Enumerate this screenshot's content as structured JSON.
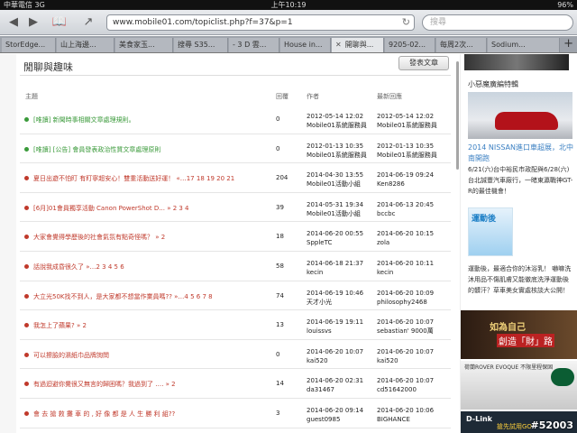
{
  "status": {
    "carrier": "中華電信 3G",
    "time": "上午10:19",
    "battery": "96%"
  },
  "browser": {
    "back": "◀",
    "forward": "▶",
    "bookmarks": "📖",
    "share": "↗",
    "url": "www.mobile01.com/topiclist.php?f=37&p=1",
    "search_placeholder": "搜尋",
    "tabs": [
      "StorEdge...",
      "山上海邊...",
      "美食家玉...",
      "搜尋 S35...",
      "- 3 D 雲...",
      "House in...",
      "開聊與...",
      "9205-02...",
      "每周2次...",
      "Sodium..."
    ],
    "new_tab": "+"
  },
  "forum": {
    "section_title": "閒聊與趣味",
    "post_button": "發表文章",
    "headers": {
      "topic": "主題",
      "replies": "回覆",
      "author": "作者",
      "last_reply": "最新回應"
    },
    "rows": [
      {
        "title": "[唯讀] 新聞時事相關文章處理規則。",
        "count": "0",
        "author_date": "2012-05-14 12:02",
        "author": "Mobile01系統服務員",
        "last_date": "2012-05-14 12:02",
        "last_author": "Mobile01系統服務員",
        "color": "#3a9a3a"
      },
      {
        "title": "[唯讀] [公告] 會員發表政治性質文章處理原則",
        "count": "0",
        "author_date": "2012-01-13 10:35",
        "author": "Mobile01系統服務員",
        "last_date": "2012-01-13 10:35",
        "last_author": "Mobile01系統服務員",
        "color": "#3a9a3a"
      },
      {
        "title": "夏日出遊不怕盯 有盯寧超安心！雙重活動送好運！ «…17 18 19 20 21",
        "count": "204",
        "author_date": "2014-04-30 13:55",
        "author": "Mobile01活動小組",
        "last_date": "2014-06-19 09:24",
        "last_author": "Ken8286",
        "color": "#c0392b"
      },
      {
        "title": "[6月]01會員獨享活動 Canon PowerShot D... » 2 3 4",
        "count": "39",
        "author_date": "2014-05-31 19:34",
        "author": "Mobile01活動小組",
        "last_date": "2014-06-13 20:45",
        "last_author": "bccbc",
        "color": "#c0392b"
      },
      {
        "title": "大家會覺得學歷後的社會氣氛有點奇怪嗎？ » 2",
        "count": "18",
        "author_date": "2014-06-20 00:55",
        "author": "SppleTC",
        "last_date": "2014-06-20 10:15",
        "last_author": "zola",
        "color": "#c0392b"
      },
      {
        "title": "話說我成昏很久了 »…2 3 4 5 6",
        "count": "58",
        "author_date": "2014-06-18 21:37",
        "author": "kecin",
        "last_date": "2014-06-20 10:11",
        "last_author": "kecin",
        "color": "#c0392b"
      },
      {
        "title": "大立光50K找不到人，是大家都不想當作業員嗎?? »…4 5 6 7 8",
        "count": "74",
        "author_date": "2014-06-19 10:46",
        "author": "天才小光",
        "last_date": "2014-06-20 10:09",
        "last_author": "philosophy2468",
        "color": "#c0392b"
      },
      {
        "title": "我怎上了蘋果? » 2",
        "count": "13",
        "author_date": "2014-06-19 19:11",
        "author": "louissvs",
        "last_date": "2014-06-20 10:07",
        "last_author": "sebastian' 9000萬",
        "color": "#c0392b"
      },
      {
        "title": "可以擦臉的濕紙巾品牌詢問",
        "count": "0",
        "author_date": "2014-06-20 10:07",
        "author": "kai520",
        "last_date": "2014-06-20 10:07",
        "last_author": "kai520",
        "color": "#c0392b"
      },
      {
        "title": "有過迴避你覺很又無言的歸困嗎？我過到了 …. » 2",
        "count": "14",
        "author_date": "2014-06-20 02:31",
        "author": "da31467",
        "last_date": "2014-06-20 10:07",
        "last_author": "cd51642000",
        "color": "#c0392b"
      },
      {
        "title": "會 去 搶 救 攤 車 的 , 好 像 都 是 人 生 勝 利 組??",
        "count": "3",
        "author_date": "2014-06-20 09:14",
        "author": "guest0985",
        "last_date": "2014-06-20 10:06",
        "last_author": "BIGHANCE",
        "color": "#c0392b"
      }
    ]
  },
  "sidebar": {
    "title": "小惡魔廣編特輯",
    "headline": "2014 NISSAN進口車超展，北中南開跑",
    "desc": "6/21(六)台中裕民市政配與6/28(六)台北誠豐汽車廠行，一睹東瀛戰神GT-R的最佳機會！",
    "img2_label": "運動後",
    "desc2": "運動後，最適合你的沐浴乳！ 嚇嘛洗沐用品不傷肌膚又能徹底洗淨運動後的髒汗？草車美女實處核談大公開！",
    "ad1_line1": "如為自己",
    "ad1_line2": "創造「財」路",
    "ad2_text": "荷蘭ROVER EVOQUE 不限里程保固",
    "ad3_text": "D-Link",
    "ad3_sub": "搶先試用GO"
  },
  "watermark": "#52003"
}
